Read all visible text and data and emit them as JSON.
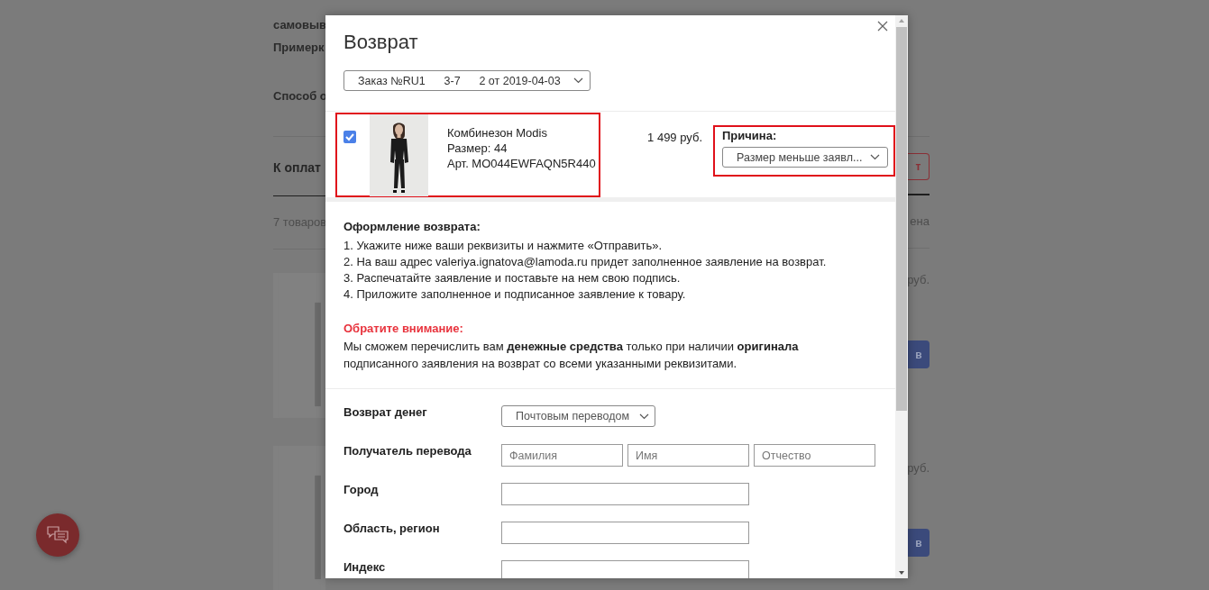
{
  "background_page": {
    "delivery_labels": [
      "самовыв",
      "Примерк",
      "Способ о"
    ],
    "total_label": "К оплат",
    "total_button": "т",
    "items_count": "7 товаров",
    "price_column": "ена",
    "items": [
      {
        "price": "руб.",
        "button": "в"
      },
      {
        "price": "руб.",
        "button": "в"
      }
    ]
  },
  "modal": {
    "title": "Возврат",
    "order_select": "Заказ №RU1      3-7      2 от 2019-04-03",
    "items": [
      {
        "checked": true,
        "name": "Комбинезон Modis",
        "size": "Размер: 44",
        "article": "Арт. MO044EWFAQN5R440",
        "price": "1 499 руб.",
        "reason_label": "Причина:",
        "reason": "Размер меньше заявл..."
      }
    ],
    "instructions": {
      "heading": "Оформление возврата:",
      "steps": [
        "1. Укажите ниже ваши реквизиты и нажмите «Отправить».",
        "2. На ваш адрес valeriya.ignatova@lamoda.ru придет заполненное заявление на возврат.",
        "3. Распечатайте заявление и поставьте на нем свою подпись.",
        "4. Приложите заполненное и подписанное заявление к товару."
      ]
    },
    "notice": {
      "heading": "Обратите внимание:",
      "text": "Мы сможем перечислить вам **денежные средства** только при наличии **оригинала** подписанного заявления на возврат со всеми указанными реквизитами."
    },
    "form": [
      {
        "kind": "select",
        "label": "Возврат денег",
        "value": "Почтовым переводом"
      },
      {
        "kind": "name",
        "label": "Получатель перевода",
        "placeholders": [
          "Фамилия",
          "Имя",
          "Отчество"
        ]
      },
      {
        "kind": "text",
        "label": "Город"
      },
      {
        "kind": "text",
        "label": "Область, регион"
      },
      {
        "kind": "text",
        "label": "Индекс"
      }
    ]
  }
}
